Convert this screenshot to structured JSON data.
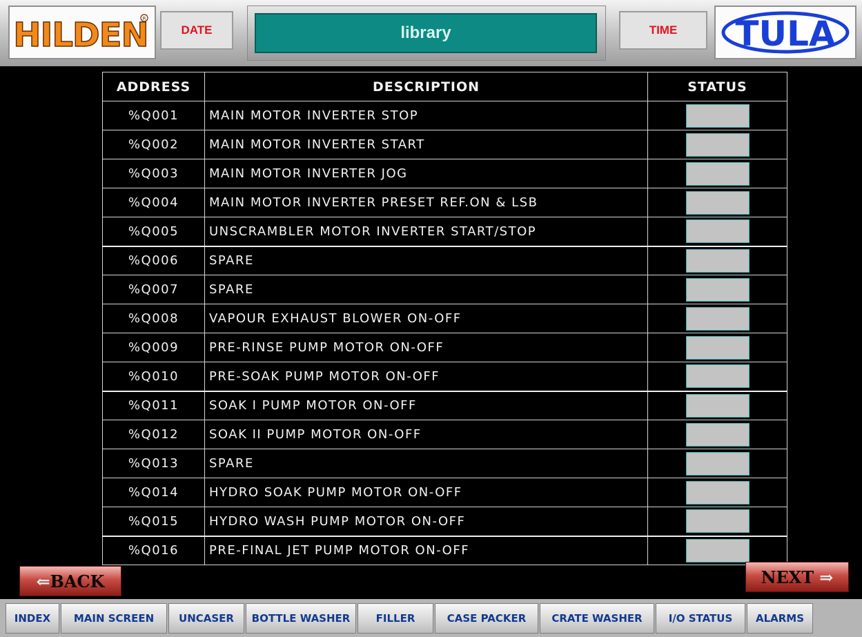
{
  "header": {
    "left_logo": "HILDEN",
    "right_logo": "TULA",
    "date_label": "DATE",
    "title": "library",
    "time_label": "TIME"
  },
  "colors": {
    "title_bg": "#0e8a84",
    "label_red": "#e0141e",
    "logo_orange": "#f08a1c",
    "logo_blue": "#1a3fd6",
    "nav_text": "#123a8f",
    "status_fill": "#c3c3c3"
  },
  "table": {
    "headers": {
      "address": "ADDRESS",
      "description": "DESCRIPTION",
      "status": "STATUS"
    },
    "rows": [
      {
        "address": "%Q001",
        "description": "MAIN MOTOR INVERTER STOP"
      },
      {
        "address": "%Q002",
        "description": "MAIN MOTOR INVERTER START"
      },
      {
        "address": "%Q003",
        "description": "MAIN MOTOR INVERTER JOG"
      },
      {
        "address": "%Q004",
        "description": "MAIN MOTOR INVERTER PRESET REF.ON & LSB"
      },
      {
        "address": "%Q005",
        "description": "UNSCRAMBLER MOTOR INVERTER START/STOP"
      },
      {
        "address": "%Q006",
        "description": "SPARE"
      },
      {
        "address": "%Q007",
        "description": "SPARE"
      },
      {
        "address": "%Q008",
        "description": "VAPOUR EXHAUST BLOWER ON-OFF"
      },
      {
        "address": "%Q009",
        "description": "PRE-RINSE PUMP MOTOR ON-OFF"
      },
      {
        "address": "%Q010",
        "description": "PRE-SOAK PUMP MOTOR ON-OFF"
      },
      {
        "address": "%Q011",
        "description": "SOAK I PUMP MOTOR ON-OFF"
      },
      {
        "address": "%Q012",
        "description": "SOAK II PUMP MOTOR ON-OFF"
      },
      {
        "address": "%Q013",
        "description": "SPARE"
      },
      {
        "address": "%Q014",
        "description": "HYDRO SOAK PUMP MOTOR ON-OFF"
      },
      {
        "address": "%Q015",
        "description": "HYDRO WASH PUMP MOTOR ON-OFF"
      },
      {
        "address": "%Q016",
        "description": "PRE-FINAL JET PUMP MOTOR ON-OFF"
      }
    ]
  },
  "nav": {
    "back_label": "BACK",
    "next_label": "NEXT",
    "bottom": [
      "INDEX",
      "MAIN SCREEN",
      "UNCASER",
      "BOTTLE WASHER",
      "FILLER",
      "CASE PACKER",
      "CRATE WASHER",
      "I/O STATUS",
      "ALARMS"
    ]
  }
}
